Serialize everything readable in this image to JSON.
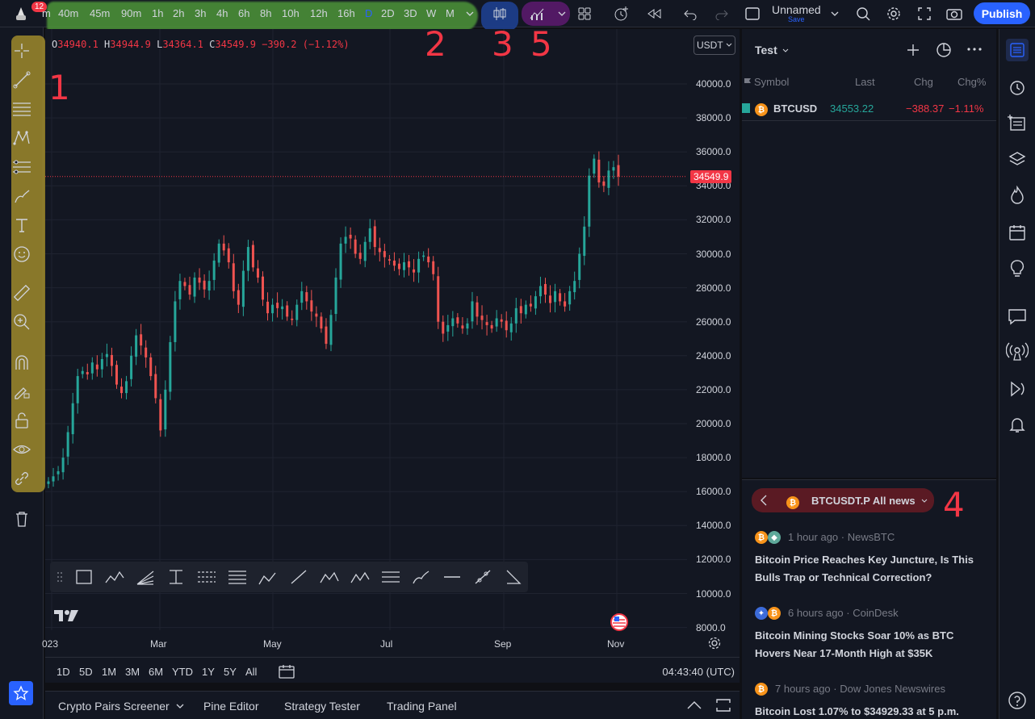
{
  "notification_count": "12",
  "timeframes": [
    "m",
    "40m",
    "45m",
    "90m",
    "1h",
    "2h",
    "3h",
    "4h",
    "6h",
    "8h",
    "10h",
    "12h",
    "16h",
    "D",
    "2D",
    "3D",
    "W",
    "M"
  ],
  "active_timeframe": "D",
  "layout_name": "Unnamed",
  "save_label": "Save",
  "publish_label": "Publish",
  "ohlc": {
    "o_key": "O",
    "o": "34940.1",
    "h_key": "H",
    "h": "34944.9",
    "l_key": "L",
    "l": "34364.1",
    "c_key": "C",
    "c": "34549.9",
    "change": "−390.2 (−1.12%)"
  },
  "currency": "USDT",
  "last_price": "34549.9",
  "price_axis": [
    "40000.0",
    "38000.0",
    "36000.0",
    "34000.0",
    "32000.0",
    "30000.0",
    "28000.0",
    "26000.0",
    "24000.0",
    "22000.0",
    "20000.0",
    "18000.0",
    "16000.0",
    "14000.0",
    "12000.0",
    "10000.0",
    "8000.0"
  ],
  "time_axis": [
    "023",
    "Mar",
    "May",
    "Jul",
    "Sep",
    "Nov"
  ],
  "annotations": [
    "1",
    "2",
    "3",
    "5",
    "4"
  ],
  "range_buttons": [
    "1D",
    "5D",
    "1M",
    "3M",
    "6M",
    "YTD",
    "1Y",
    "5Y",
    "All"
  ],
  "clock": "04:43:40 (UTC)",
  "bottom_tabs": [
    "Crypto Pairs Screener",
    "Pine Editor",
    "Strategy Tester",
    "Trading Panel"
  ],
  "watchlist": {
    "title": "Test",
    "columns": [
      "Symbol",
      "Last",
      "Chg",
      "Chg%"
    ],
    "rows": [
      {
        "symbol": "BTCUSD",
        "last": "34553.22",
        "chg": "−388.37",
        "chgp": "−1.11%"
      }
    ]
  },
  "news": {
    "header": "BTCUSDT.P All news",
    "items": [
      {
        "meta": "1 hour ago · NewsBTC",
        "title": "Bitcoin Price Reaches Key Juncture, Is This Bulls Trap or Technical Correction?"
      },
      {
        "meta": "6 hours ago · CoinDesk",
        "title": "Bitcoin Mining Stocks Soar 10% as BTC Hovers Near 17-Month High at $35K"
      },
      {
        "meta": "7 hours ago · Dow Jones Newswires",
        "title": "Bitcoin Lost 1.07% to $34929.33 at 5 p.m."
      }
    ]
  },
  "colors": {
    "up": "#26a69a",
    "down": "#ef5350",
    "accent": "#2962ff"
  },
  "candle_series": {
    "note": "",
    "closes": [
      16600,
      16900,
      17200,
      18000,
      19500,
      21200,
      22800,
      23100,
      22900,
      23600,
      23200,
      23800,
      24100,
      23400,
      22300,
      21800,
      22500,
      24000,
      25200,
      24600,
      23900,
      22800,
      21500,
      19600,
      22000,
      24800,
      27200,
      28400,
      28100,
      27600,
      28600,
      28300,
      27900,
      28400,
      29600,
      30600,
      30200,
      29500,
      27800,
      27000,
      29000,
      30400,
      29200,
      28600,
      27300,
      26500,
      27000,
      26800,
      26900,
      26300,
      26100,
      27000,
      27800,
      27200,
      26600,
      26300,
      25600,
      24700,
      26400,
      28600,
      30600,
      31000,
      30900,
      30000,
      29700,
      30700,
      31500,
      30400,
      30100,
      29800,
      29600,
      29300,
      29100,
      29500,
      29200,
      28900,
      29700,
      29900,
      29500,
      28800,
      26000,
      25300,
      25800,
      26200,
      25900,
      25600,
      25900,
      27200,
      26300,
      26100,
      25800,
      25600,
      26200,
      26000,
      25500,
      25900,
      26800,
      26500,
      27000,
      26900,
      27500,
      28100,
      27600,
      27100,
      27800,
      27200,
      26900,
      27800,
      28400,
      30000,
      31600,
      34600,
      35600,
      34200,
      34000,
      34900,
      35100,
      34550
    ]
  }
}
